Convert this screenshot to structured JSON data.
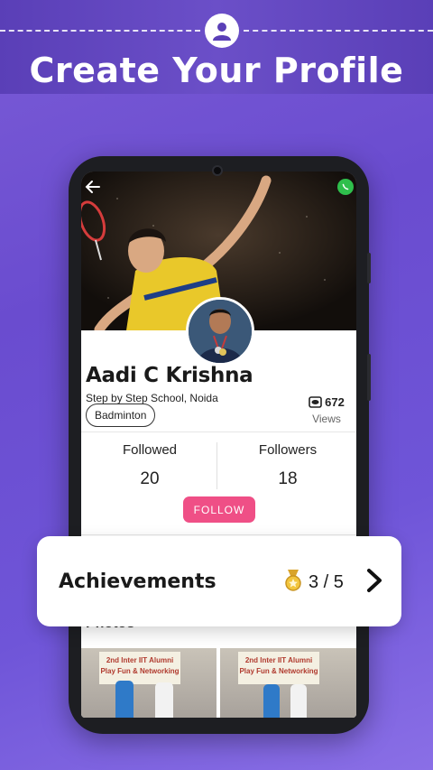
{
  "banner": {
    "headline": "Create Your Profile",
    "icon": "user-avatar-icon"
  },
  "profile": {
    "name": "Aadi C Krishna",
    "school": "Step by Step School, Noida",
    "sport": "Badminton",
    "views_count": "672",
    "views_label": "Views"
  },
  "stats": {
    "followed_label": "Followed",
    "followed_value": "20",
    "followers_label": "Followers",
    "followers_value": "18"
  },
  "follow_button": "FOLLOW",
  "photos": {
    "title": "Photos",
    "items": [
      {
        "banner": "2nd Inter IIT Alumni\nPlay Fun & Networking"
      },
      {
        "banner": "2nd Inter IIT Alumni\nPlay Fun & Networking"
      }
    ]
  },
  "achievements": {
    "title": "Achievements",
    "count": "3 / 5",
    "icon": "medal-icon"
  },
  "colors": {
    "background": "#6a4ccf",
    "follow_button": "#ef4f86",
    "whatsapp": "#2fbf4c"
  }
}
